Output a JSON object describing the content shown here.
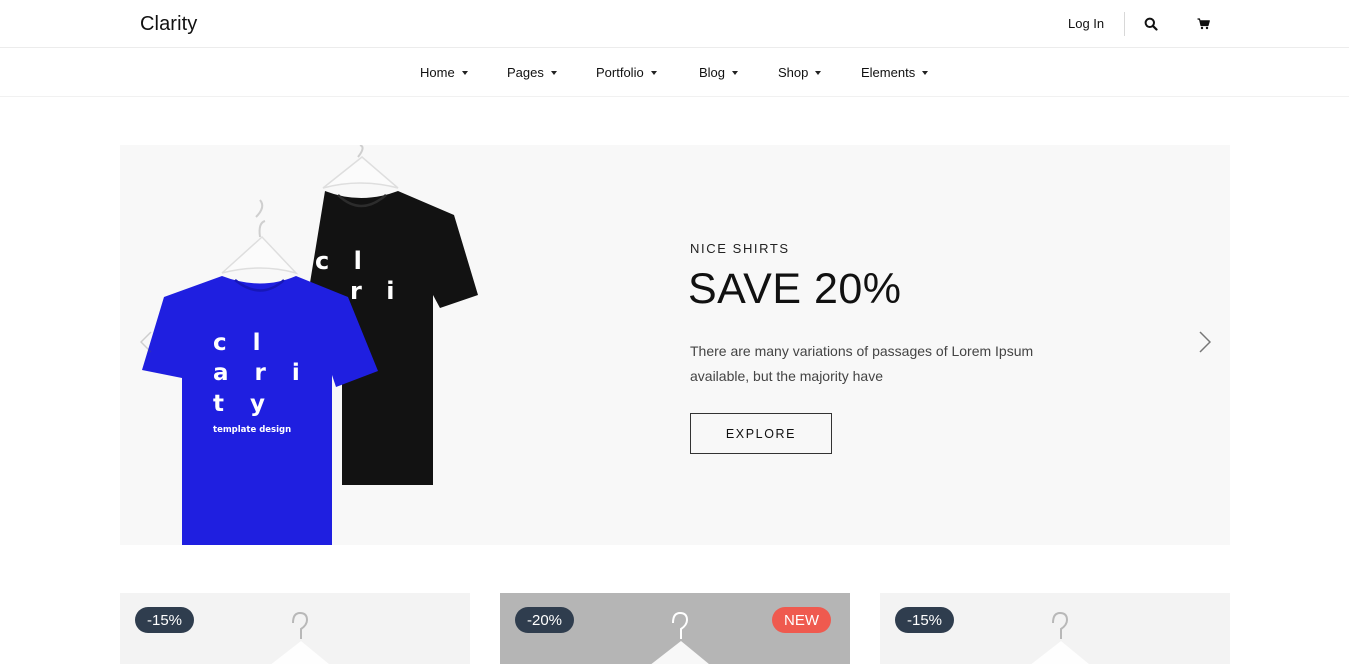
{
  "header": {
    "logo": "Clarity",
    "login_label": "Log In",
    "icons": [
      "search-icon",
      "cart-icon"
    ]
  },
  "nav": {
    "items": [
      {
        "label": "Home"
      },
      {
        "label": "Pages"
      },
      {
        "label": "Portfolio"
      },
      {
        "label": "Blog"
      },
      {
        "label": "Shop"
      },
      {
        "label": "Elements"
      }
    ]
  },
  "hero": {
    "eyebrow": "NICE SHIRTS",
    "headline": "SAVE 20%",
    "description": "There are many variations of passages of Lorem Ipsum available, but the majority have",
    "cta_label": "EXPLORE",
    "shirt_front_text": [
      "c l",
      "a r i",
      "t y",
      "template design"
    ],
    "shirt_back_text": [
      "c l",
      "r i"
    ],
    "colors": {
      "front_shirt": "#1f1fe0",
      "back_shirt": "#111111",
      "background": "#f8f8f8"
    }
  },
  "products": [
    {
      "discount": "-15%",
      "badge_new": ""
    },
    {
      "discount": "-20%",
      "badge_new": "NEW"
    },
    {
      "discount": "-15%",
      "badge_new": ""
    }
  ],
  "colors": {
    "badge_dark": "#2f3d4e",
    "badge_new": "#ef5a4f"
  }
}
